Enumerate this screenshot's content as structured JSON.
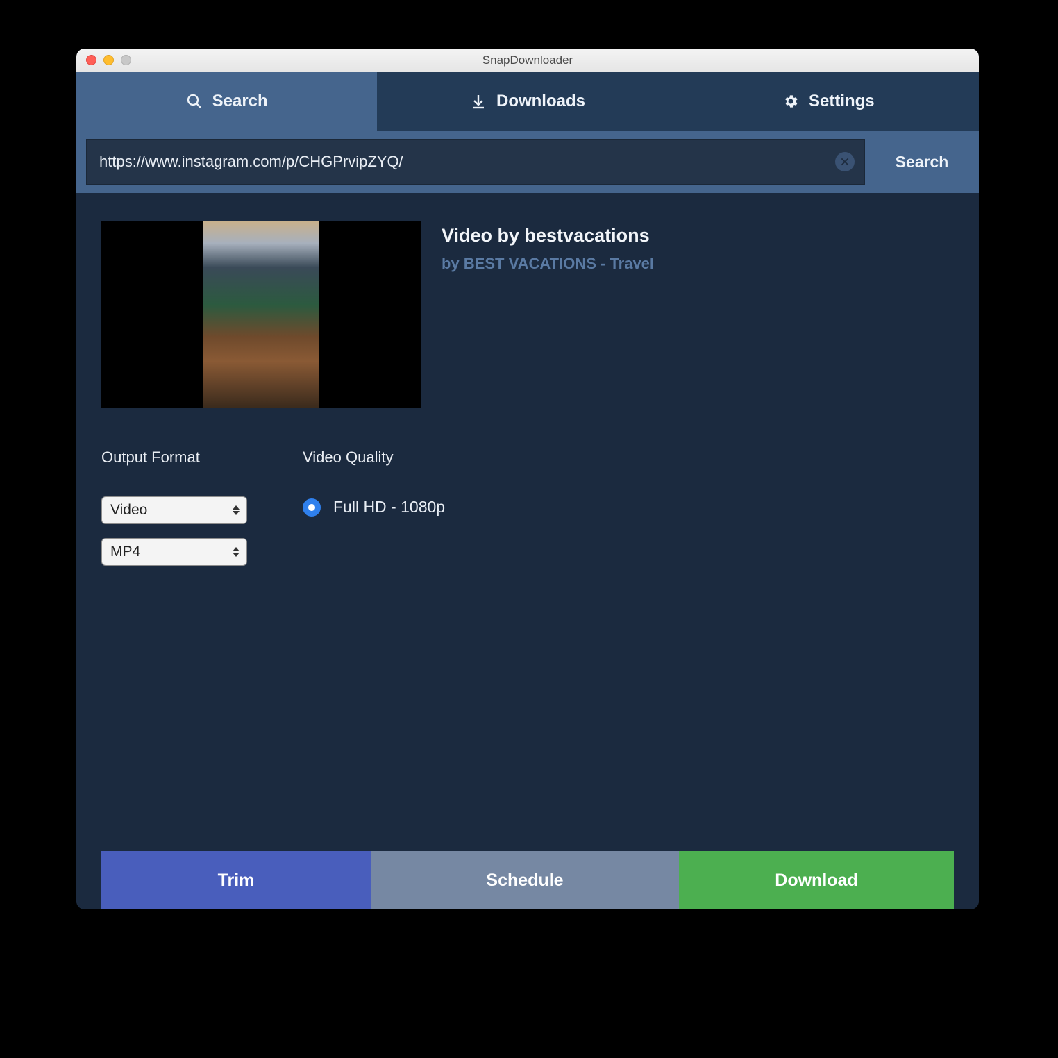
{
  "window": {
    "title": "SnapDownloader"
  },
  "tabs": {
    "search": {
      "label": "Search",
      "icon": "search-icon"
    },
    "downloads": {
      "label": "Downloads",
      "icon": "download-icon"
    },
    "settings": {
      "label": "Settings",
      "icon": "gear-icon"
    },
    "active": "search"
  },
  "search": {
    "url_value": "https://www.instagram.com/p/CHGPrvipZYQ/",
    "search_button": "Search"
  },
  "video": {
    "title": "Video by bestvacations",
    "byline": "by BEST VACATIONS - Travel"
  },
  "format": {
    "heading": "Output Format",
    "type_value": "Video",
    "container_value": "MP4"
  },
  "quality": {
    "heading": "Video Quality",
    "options": [
      {
        "label": "Full HD - 1080p",
        "selected": true
      }
    ]
  },
  "actions": {
    "trim": "Trim",
    "schedule": "Schedule",
    "download": "Download"
  },
  "colors": {
    "tab_active": "#45658d",
    "tab_bg": "#233b57",
    "content_bg": "#1b2a3f",
    "trim": "#495ebc",
    "schedule": "#7688a3",
    "download": "#4caf50",
    "radio": "#2f80ed"
  }
}
